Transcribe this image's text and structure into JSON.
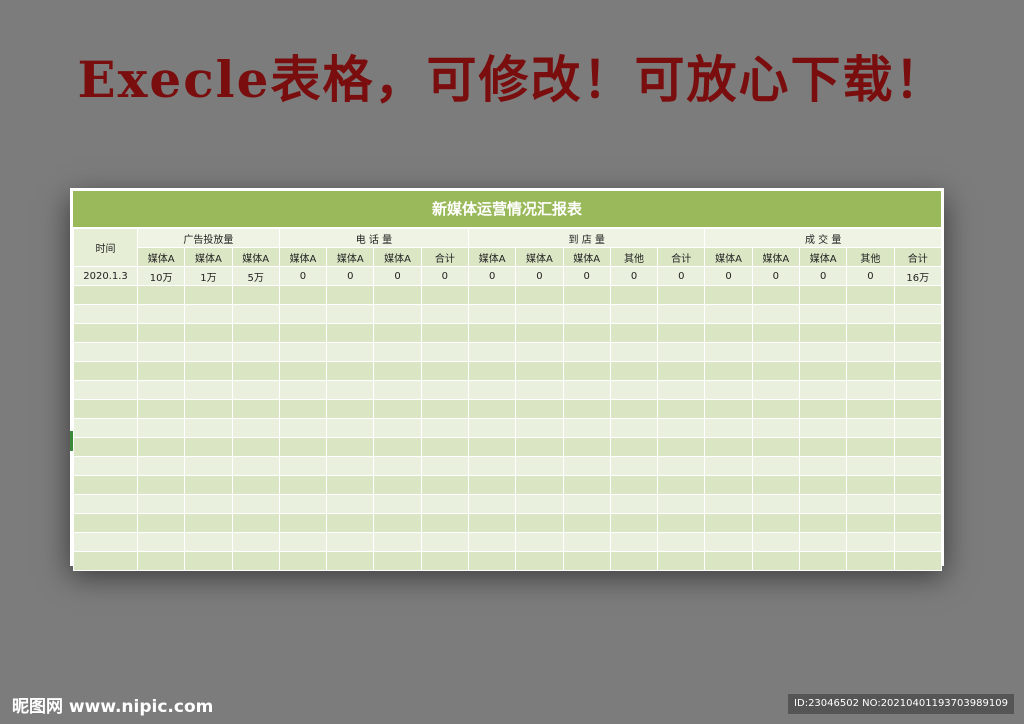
{
  "banner": "Execle表格，可修改！可放心下载！",
  "sheet": {
    "title": "新媒体运营情况汇报表",
    "time_header": "时间",
    "groups": [
      "广告投放量",
      "电 话 量",
      "到 店 量",
      "成 交 量"
    ],
    "subheaders": [
      "媒体A",
      "媒体A",
      "媒体A",
      "媒体A",
      "媒体A",
      "媒体A",
      "合计",
      "媒体A",
      "媒体A",
      "媒体A",
      "其他",
      "合计",
      "媒体A",
      "媒体A",
      "媒体A",
      "其他",
      "合计"
    ],
    "row1": {
      "date": "2020.1.3",
      "values": [
        "10万",
        "1万",
        "5万",
        "0",
        "0",
        "0",
        "0",
        "0",
        "0",
        "0",
        "0",
        "0",
        "0",
        "0",
        "0",
        "0",
        "16万"
      ]
    },
    "empty_rows": 15
  },
  "footer": {
    "logo": "昵图网 www.nipic.com",
    "id": "ID:23046502 NO:20210401193703989109"
  }
}
